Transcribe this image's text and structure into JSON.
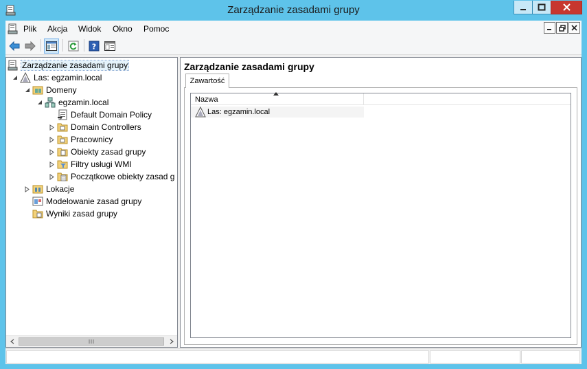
{
  "window": {
    "title": "Zarządzanie zasadami grupy"
  },
  "menu": {
    "items": [
      "Plik",
      "Akcja",
      "Widok",
      "Okno",
      "Pomoc"
    ]
  },
  "toolbar": {
    "buttons": [
      "back-icon",
      "forward-icon",
      "show-hide-tree-icon",
      "refresh-icon",
      "help-icon",
      "properties-icon"
    ]
  },
  "tree": {
    "root": "Zarządzanie zasadami grupy",
    "forest": "Las: egzamin.local",
    "domains": "Domeny",
    "domain": "egzamin.local",
    "default_policy": "Default Domain Policy",
    "domain_controllers": "Domain Controllers",
    "employees": "Pracownicy",
    "gpo_objects": "Obiekty zasad grupy",
    "wmi_filters": "Filtry usługi WMI",
    "starter_gpos": "Początkowe obiekty zasad g",
    "sites": "Lokacje",
    "modeling": "Modelowanie zasad grupy",
    "results": "Wyniki zasad grupy"
  },
  "content": {
    "title": "Zarządzanie zasadami grupy",
    "tab": "Zawartość",
    "column_name": "Nazwa",
    "rows": [
      "Las: egzamin.local"
    ]
  },
  "colors": {
    "frame": "#5ec3ea",
    "selection": "#e5f3fb",
    "close_button": "#c7372f"
  }
}
